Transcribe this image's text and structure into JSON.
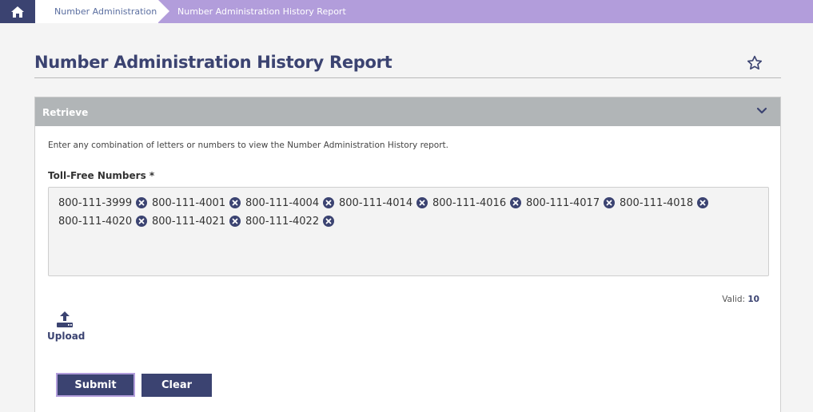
{
  "breadcrumb": {
    "home_icon": "home-icon",
    "items": [
      "Number Administration",
      "Number Administration History Report"
    ]
  },
  "page": {
    "title": "Number Administration History Report",
    "favorite_icon": "star-icon"
  },
  "panel": {
    "title": "Retrieve",
    "toggle_icon": "chevron-down-icon",
    "instructions": "Enter any combination of letters or numbers to view the Number Administration History report.",
    "field_label": "Toll-Free Numbers *",
    "numbers": [
      "800-111-3999",
      "800-111-4001",
      "800-111-4004",
      "800-111-4014",
      "800-111-4016",
      "800-111-4017",
      "800-111-4018",
      "800-111-4020",
      "800-111-4021",
      "800-111-4022"
    ],
    "valid_label": "Valid:",
    "valid_count": "10",
    "upload_label": "Upload",
    "submit_label": "Submit",
    "clear_label": "Clear"
  },
  "colors": {
    "navy": "#3b4371",
    "lavender": "#b29ddb",
    "panel_header": "#b1b5b7"
  }
}
